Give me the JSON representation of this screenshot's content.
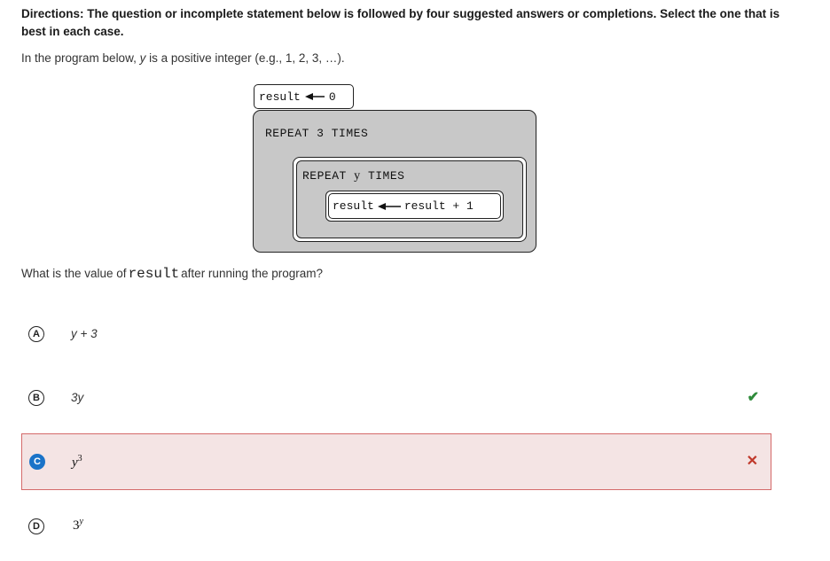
{
  "directions": "Directions: The question or incomplete statement below is followed by four suggested answers or completions. Select the one that is best in each case.",
  "intro": {
    "prefix": "In the program below, ",
    "var": "y",
    "suffix": " is a positive integer (e.g., 1, 2, 3, …)."
  },
  "program": {
    "top_assign": {
      "target": "result",
      "value": "0"
    },
    "outer_repeat": {
      "keyword": "REPEAT",
      "count": "3",
      "times": "TIMES"
    },
    "inner_repeat": {
      "keyword": "REPEAT",
      "count": "y",
      "times": "TIMES"
    },
    "inner_assign": {
      "target": "result",
      "expr": "result + 1"
    }
  },
  "question": {
    "prefix": "What is the value of",
    "code": "result",
    "suffix": "after running the program?"
  },
  "options": [
    {
      "letter": "A",
      "base": "y + 3",
      "sup": "",
      "state": "none"
    },
    {
      "letter": "B",
      "base": "3y",
      "sup": "",
      "state": "correct"
    },
    {
      "letter": "C",
      "base": "y",
      "sup": "3",
      "state": "incorrect"
    },
    {
      "letter": "D",
      "base": "3",
      "sup": "y",
      "state": "none"
    }
  ],
  "icons": {
    "correct": "check-icon",
    "incorrect": "cross-icon"
  },
  "colors": {
    "correct": "#2e8b3a",
    "incorrect": "#c0392b",
    "selected": "#1a73c8",
    "incorrect_bg": "#f4e4e4"
  }
}
